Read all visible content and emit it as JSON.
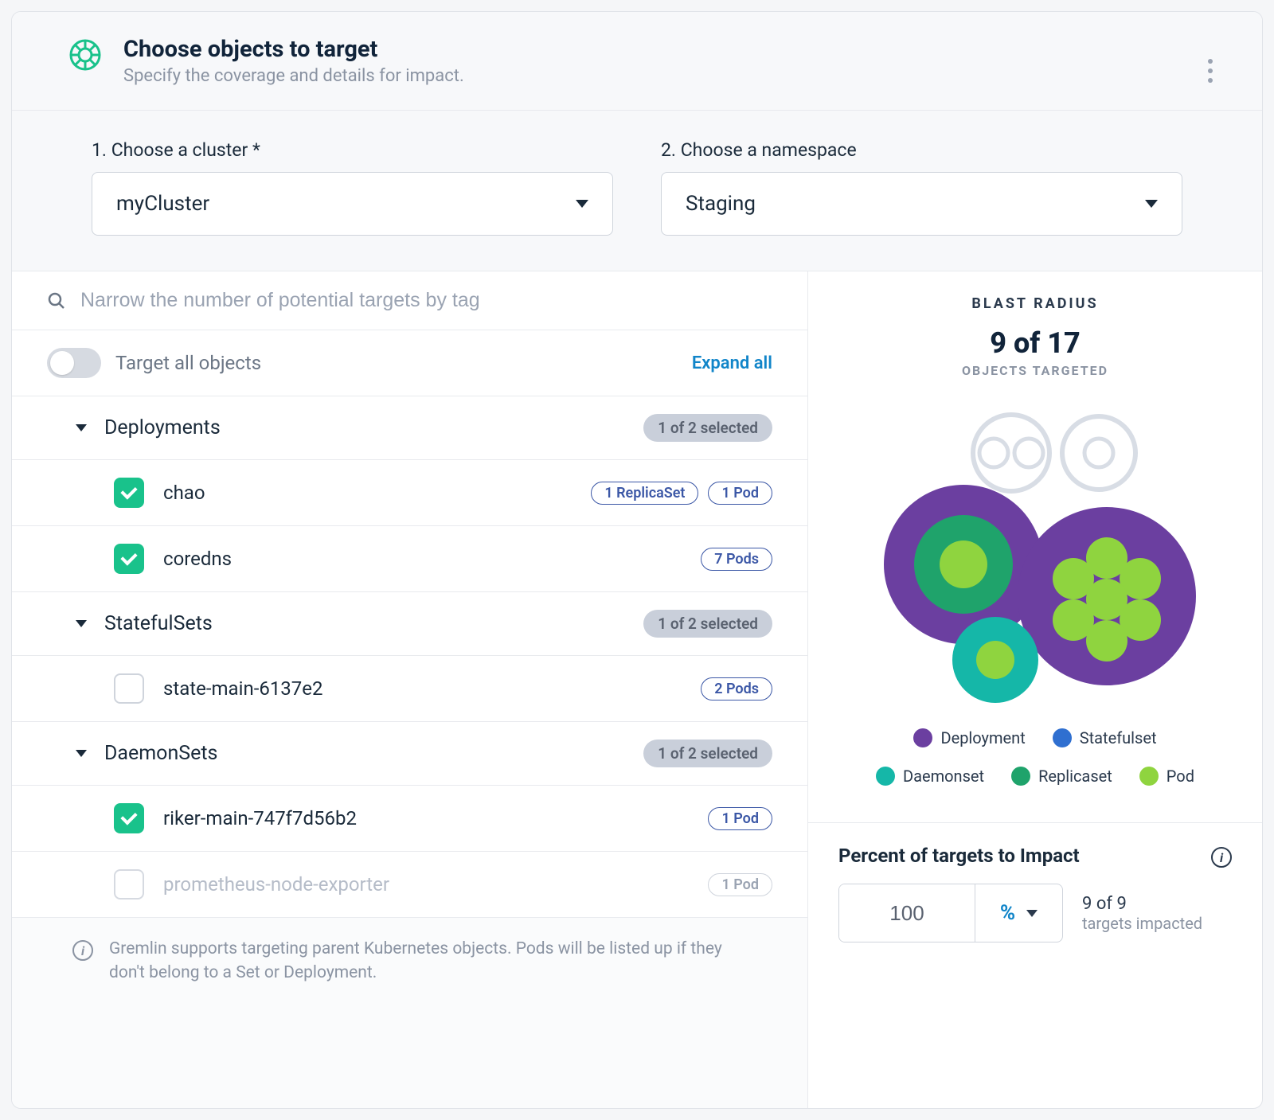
{
  "header": {
    "title": "Choose objects to target",
    "subtitle": "Specify the coverage and details for impact."
  },
  "selectors": {
    "cluster_label": "1. Choose a cluster *",
    "cluster_value": "myCluster",
    "namespace_label": "2. Choose a namespace",
    "namespace_value": "Staging"
  },
  "search": {
    "placeholder": "Narrow the number of potential targets by tag"
  },
  "toggle": {
    "label": "Target all objects",
    "expand_link": "Expand all"
  },
  "groups": {
    "deployments": {
      "title": "Deployments",
      "selected_text": "1 of 2 selected",
      "items": [
        {
          "label": "chao",
          "checked": true,
          "pills": [
            "1 ReplicaSet",
            "1 Pod"
          ]
        },
        {
          "label": "coredns",
          "checked": true,
          "pills": [
            "7 Pods"
          ]
        }
      ]
    },
    "statefulsets": {
      "title": "StatefulSets",
      "selected_text": "1 of 2 selected",
      "items": [
        {
          "label": "state-main-6137e2",
          "checked": false,
          "pills": [
            "2 Pods"
          ]
        }
      ]
    },
    "daemonsets": {
      "title": "DaemonSets",
      "selected_text": "1 of 2 selected",
      "items": [
        {
          "label": "riker-main-747f7d56b2",
          "checked": true,
          "pills": [
            "1 Pod"
          ]
        },
        {
          "label": "prometheus-node-exporter",
          "checked": false,
          "disabled": true,
          "pills": [
            "1 Pod"
          ]
        }
      ]
    }
  },
  "footer_note": "Gremlin supports targeting parent Kubernetes objects. Pods will be listed up if they don't belong to a Set or Deployment.",
  "blast": {
    "title": "BLAST RADIUS",
    "count": "9 of 17",
    "subtitle": "OBJECTS TARGETED",
    "legend": [
      {
        "label": "Deployment",
        "color": "#6b3fa0"
      },
      {
        "label": "Statefulset",
        "color": "#2f6fd0"
      },
      {
        "label": "Daemonset",
        "color": "#15b7a8"
      },
      {
        "label": "Replicaset",
        "color": "#1fa36b"
      },
      {
        "label": "Pod",
        "color": "#8fd43f"
      }
    ]
  },
  "impact": {
    "title": "Percent of targets to Impact",
    "value": "100",
    "unit": "%",
    "summary_line1": "9 of 9",
    "summary_line2": "targets impacted"
  },
  "colors": {
    "deployment": "#6b3fa0",
    "statefulset": "#2f6fd0",
    "daemonset": "#15b7a8",
    "replicaset": "#1fa36b",
    "pod": "#8fd43f",
    "outline": "#d8dde5"
  }
}
